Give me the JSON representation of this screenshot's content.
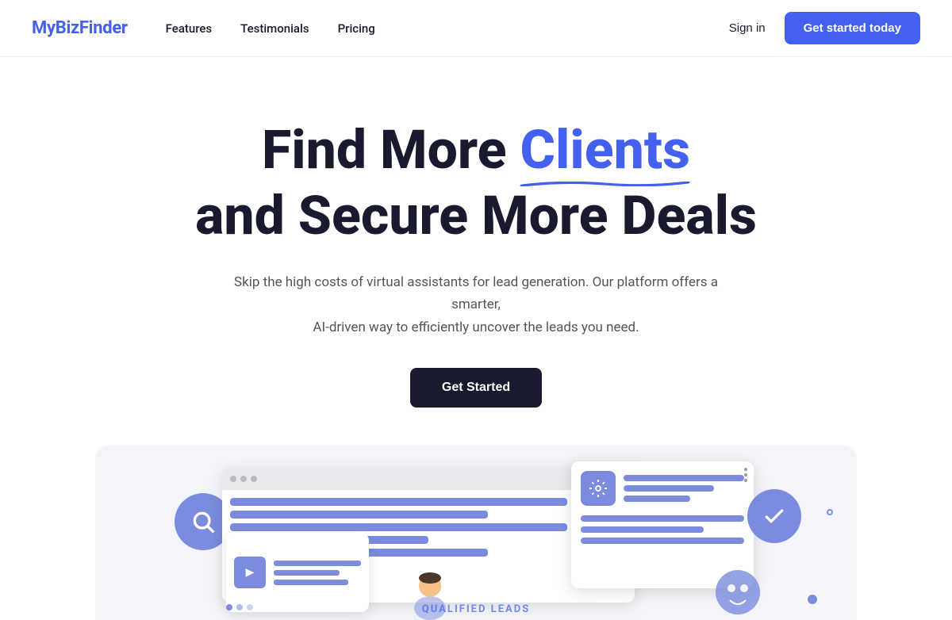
{
  "logo": {
    "prefix": "MyBiz",
    "suffix": "Finder"
  },
  "nav": {
    "links": [
      {
        "label": "Features",
        "id": "features"
      },
      {
        "label": "Testimonials",
        "id": "testimonials"
      },
      {
        "label": "Pricing",
        "id": "pricing"
      }
    ],
    "sign_in_label": "Sign in",
    "cta_label": "Get started today"
  },
  "hero": {
    "title_line1_plain": "Find More ",
    "title_line1_blue": "Clients",
    "title_line2": "and Secure More Deals",
    "description_line1": "Skip the high costs of virtual assistants for lead generation. Our platform offers a smarter,",
    "description_line2": "AI-driven way to efficiently uncover the leads you need.",
    "cta_label": "Get Started"
  },
  "illustration": {
    "qualified_leads_label": "QUALIFIED LEADS"
  },
  "colors": {
    "brand_blue": "#4361ee",
    "dark": "#1a1a2e",
    "purple_light": "#7b8cde",
    "bg_light": "#f4f5fb"
  }
}
